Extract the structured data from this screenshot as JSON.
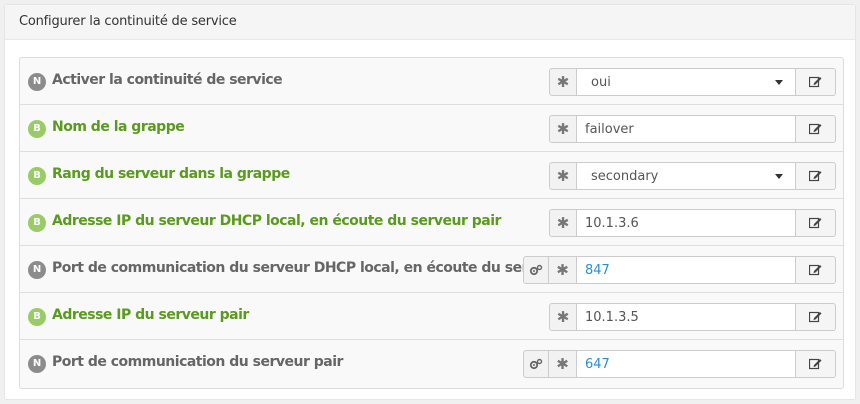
{
  "panel": {
    "title": "Configurer la continuité de service"
  },
  "colors": {
    "badge_N": "#8c8c8c",
    "badge_B": "#99cc66",
    "label_N": "#666666",
    "label_B": "#5a9a1f",
    "value_link": "#2a8fd6"
  },
  "icons": {
    "required": "asterisk-icon",
    "edit": "edit-icon",
    "advanced": "gears-icon",
    "dropdown": "caret-down-icon"
  },
  "rows": [
    {
      "badge": "N",
      "label": "Activer la continuité de service",
      "value": "oui"
    },
    {
      "badge": "B",
      "label": "Nom de la grappe",
      "value": "failover"
    },
    {
      "badge": "B",
      "label": "Rang du serveur dans la grappe",
      "value": "secondary"
    },
    {
      "badge": "B",
      "label": "Adresse IP du serveur DHCP local, en écoute du serveur pair",
      "value": "10.1.3.6"
    },
    {
      "badge": "N",
      "label": "Port de communication du serveur DHCP local, en écoute du serveur pair",
      "value": "847"
    },
    {
      "badge": "B",
      "label": "Adresse IP du serveur pair",
      "value": "10.1.3.5"
    },
    {
      "badge": "N",
      "label": "Port de communication du serveur pair",
      "value": "647"
    }
  ]
}
